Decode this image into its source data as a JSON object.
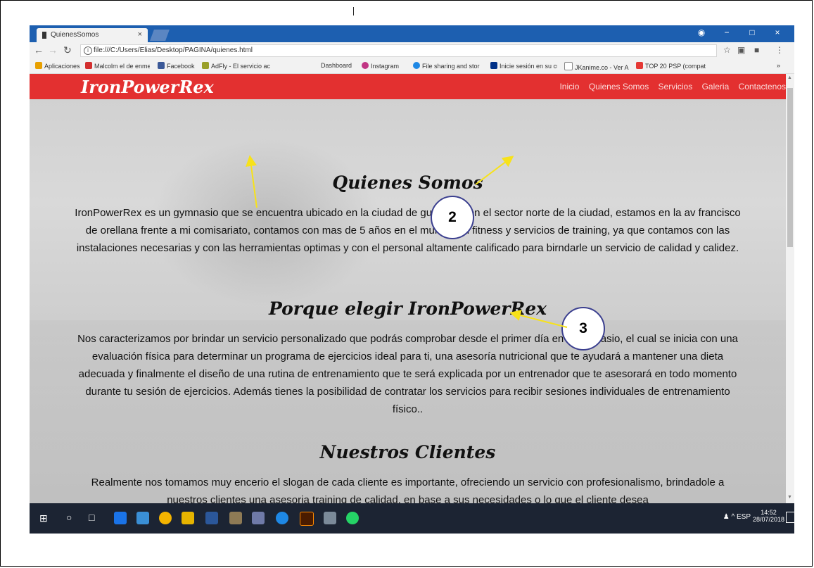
{
  "browser": {
    "tab_title": "QuienesSomos",
    "tab_close": "×",
    "address_url": "file:///C:/Users/Elias/Desktop/PAGINA/quienes.html",
    "window_controls": [
      "−",
      "□",
      "×"
    ],
    "bookmarks": [
      {
        "label": "Aplicaciones",
        "color": "#e8a000"
      },
      {
        "label": "Malcolm el de enme",
        "color": "#d32f2f"
      },
      {
        "label": "Facebook",
        "color": "#3b5998"
      },
      {
        "label": "AdFly - El servicio ac",
        "color": "#9aa02a"
      },
      {
        "label": "Dashboard",
        "color": "#cfcfcf"
      },
      {
        "label": "Instagram",
        "color": "#c13584"
      },
      {
        "label": "File sharing and stor",
        "color": "#1e88e5"
      },
      {
        "label": "Inicie sesión en su cu",
        "color": "#003087"
      },
      {
        "label": "JKanime.co - Ver Ani",
        "color": "#9e9e9e"
      },
      {
        "label": "TOP 20 PSP (compat",
        "color": "#e53935"
      }
    ],
    "bookmarks_more": "»"
  },
  "site": {
    "logo": "IronPowerRex",
    "nav": [
      "Inicio",
      "Quienes Somos",
      "Servicios",
      "Galeria",
      "Contactenos"
    ],
    "brand_color": "#e33030",
    "sections": {
      "s1_title": "Quienes Somos",
      "s1_text": "IronPowerRex es un gymnasio que se encuentra ubicado en la ciudad de guayaquil en el sector norte de la ciudad, estamos en la av francisco de orellana frente a mi comisariato, contamos con mas de 5 años en el mundo del fitness y servicios de training, ya que contamos con las instalaciones necesarias y con las herramientas optimas y con el personal altamente calificado para birndarle un servicio de calidad y calidez.",
      "s2_title": "Porque elegir IronPowerRex",
      "s2_text": "Nos caracterizamos por brindar un servicio personalizado que podrás comprobar desde el primer día en el gimnasio, el cual se inicia con una evaluación física para determinar un programa de ejercicios ideal para ti, una asesoría nutricional que te ayudará a mantener una dieta adecuada y finalmente el diseño de una rutina de entrenamiento que te será explicada por un entrenador que te asesorará en todo momento durante tu sesión de ejercicios. Además tienes la posibilidad de contratar los servicios para recibir sesiones individuales de entrenamiento físico..",
      "s3_title": "Nuestros Clientes",
      "s3_text": "Realmente nos tomamos muy encerio el slogan de cada cliente es importante, ofreciendo un servicio con profesionalismo, brindadole a nuestros clientes una asesoria training de calidad, en base a sus necesidades o lo que el cliente desea"
    }
  },
  "taskbar": {
    "tray_lang": "ESP",
    "time": "14:52",
    "date": "28/07/2018",
    "tray_caret": "^"
  },
  "annotations": {
    "callout_2": "2",
    "callout_3": "3",
    "arrow_color": "#f7e21a"
  }
}
